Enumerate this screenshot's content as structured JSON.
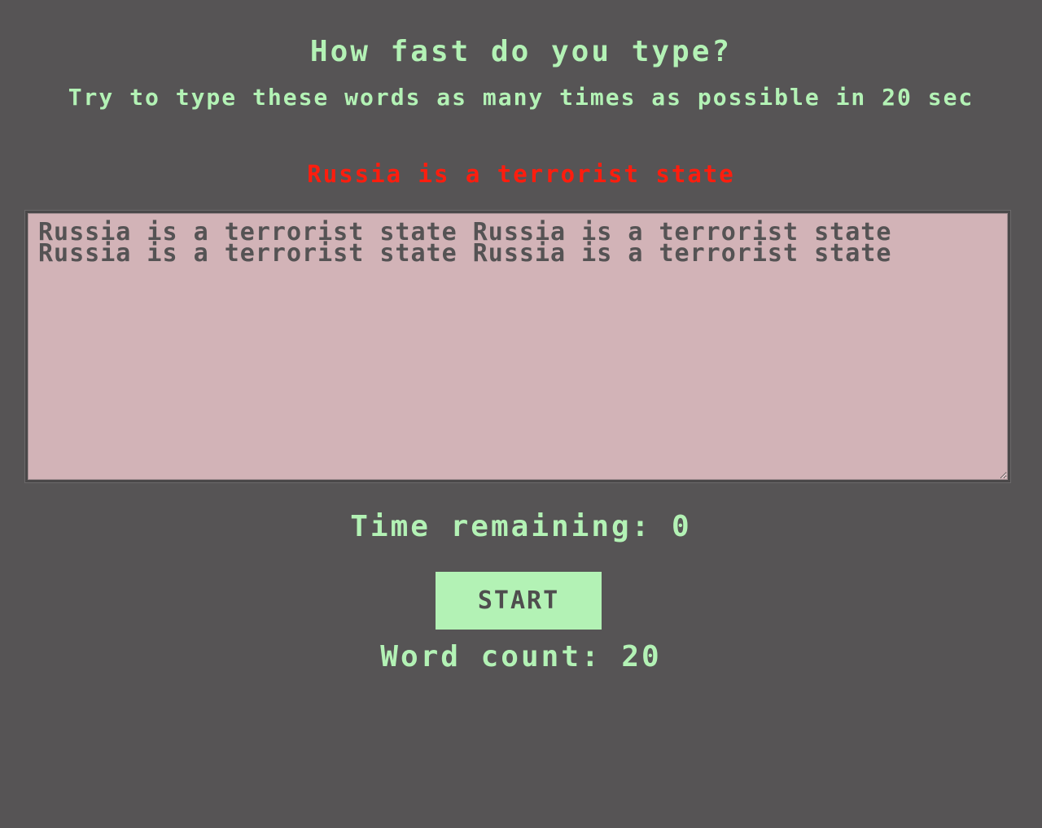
{
  "header": {
    "title": "How fast do you type?",
    "instructions": "Try to type these words as many times as possible in 20 sec",
    "target_phrase": "Russia is a terrorist state"
  },
  "typing_area": {
    "value": "Russia is a terrorist state Russia is a terrorist state Russia is a terrorist state Russia is a terrorist state",
    "placeholder": ""
  },
  "timer": {
    "label": "Time remaining:",
    "value": "0"
  },
  "controls": {
    "start_label": "START"
  },
  "stats": {
    "word_count_label": "Word count:",
    "word_count_value": "20"
  },
  "colors": {
    "background": "#565455",
    "accent_green": "#b3f2b5",
    "target_red": "#ff1d0e",
    "textarea_bg": "#d2b3b7",
    "textarea_text": "#555354"
  }
}
